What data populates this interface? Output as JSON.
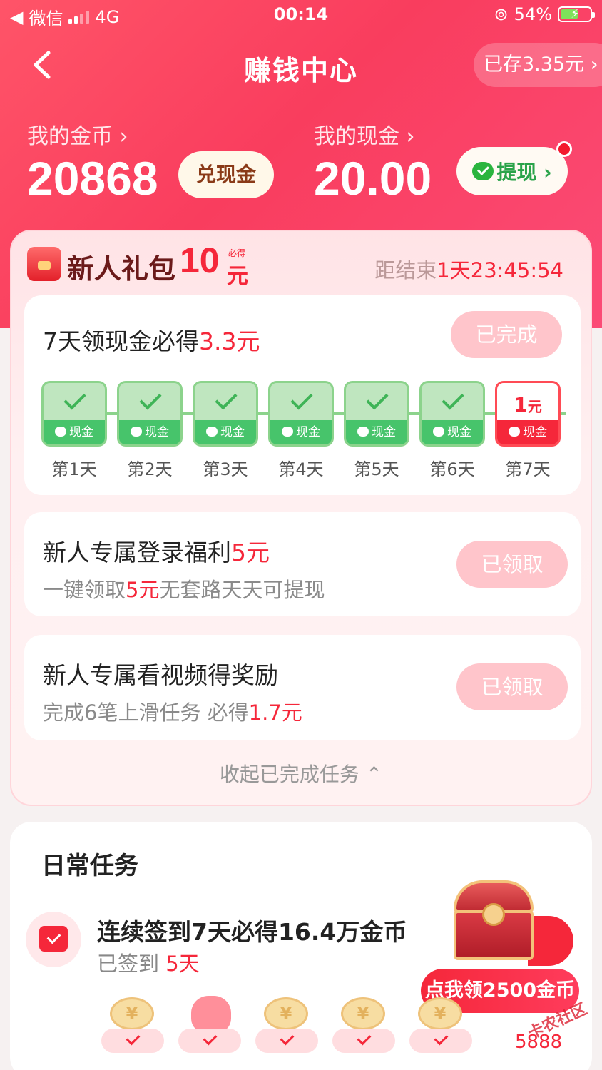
{
  "status_bar": {
    "carrier": "微信",
    "network": "4G",
    "time": "00:14",
    "battery": "54%"
  },
  "nav": {
    "title": "赚钱中心",
    "saved": "已存3.35元 ›"
  },
  "wallet": {
    "coins_label": "我的金币 ›",
    "coins_value": "20868",
    "exchange_label": "兑现金",
    "cash_label": "我的现金 ›",
    "cash_value": "20.00",
    "withdraw_label": "提现 ›"
  },
  "newbie": {
    "title": "新人礼包",
    "amount": "10",
    "unit": "元",
    "tag": "必得",
    "countdown_prefix": "距结束",
    "countdown_value": "1天23:45:54",
    "seven_day": {
      "title": "7天领现金必得",
      "title_amount": "3.3元",
      "button": "已完成",
      "days": [
        {
          "label": "第1天",
          "reward": "现金",
          "done": true
        },
        {
          "label": "第2天",
          "reward": "现金",
          "done": true
        },
        {
          "label": "第3天",
          "reward": "现金",
          "done": true
        },
        {
          "label": "第4天",
          "reward": "现金",
          "done": true
        },
        {
          "label": "第5天",
          "reward": "现金",
          "done": true
        },
        {
          "label": "第6天",
          "reward": "现金",
          "done": true
        },
        {
          "label": "第7天",
          "reward": "现金",
          "done": false,
          "amount": "1",
          "amount_unit": "元"
        }
      ]
    },
    "login_bonus": {
      "title": "新人专属登录福利",
      "title_amount": "5元",
      "sub_prefix": "一键领取",
      "sub_amount": "5元",
      "sub_suffix": "无套路天天可提现",
      "button": "已领取"
    },
    "video_bonus": {
      "title": "新人专属看视频得奖励",
      "sub_prefix": "完成6笔上滑任务 必得",
      "sub_amount": "1.7元",
      "button": "已领取"
    },
    "collapse_label": "收起已完成任务 ⌃"
  },
  "daily": {
    "title": "日常任务",
    "signin_title": "连续签到7天必得16.4万金币",
    "signin_sub_prefix": "已签到 ",
    "signin_sub_days": "5天",
    "claim_button": "点我领2500金币",
    "bottom_amount": "5888",
    "watermark": "卡农社区"
  },
  "colors": {
    "accent": "#f5273a",
    "hero": "#f93d5e",
    "success": "#47c46b"
  }
}
